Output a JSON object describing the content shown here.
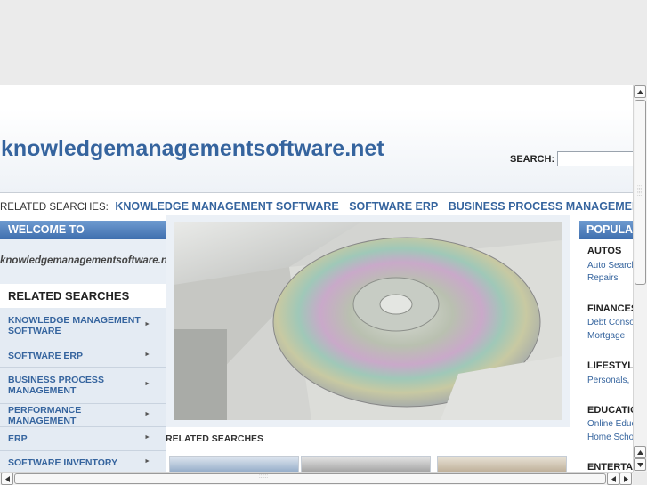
{
  "site": {
    "title": "knowledgemanagementsoftware.net"
  },
  "search": {
    "label": "SEARCH:",
    "value": ""
  },
  "related_bar": {
    "label": "RELATED SEARCHES:",
    "links": [
      "KNOWLEDGE MANAGEMENT SOFTWARE",
      "SOFTWARE ERP",
      "BUSINESS PROCESS MANAGEMENT"
    ]
  },
  "welcome": {
    "heading": "WELCOME TO",
    "domain": "knowledgemanagementsoftware.net"
  },
  "sidebar": {
    "heading": "RELATED SEARCHES",
    "items": [
      {
        "label": "KNOWLEDGE MANAGEMENT SOFTWARE"
      },
      {
        "label": "SOFTWARE ERP"
      },
      {
        "label": "BUSINESS PROCESS MANAGEMENT"
      },
      {
        "label": "PERFORMANCE MANAGEMENT"
      },
      {
        "label": "ERP"
      },
      {
        "label": "SOFTWARE INVENTORY"
      }
    ]
  },
  "center": {
    "related_label": "RELATED SEARCHES"
  },
  "popular": {
    "heading": "POPULAR",
    "categories": [
      {
        "name": "AUTOS",
        "links": [
          "Auto Search",
          "Repairs"
        ]
      },
      {
        "name": "FINANCES",
        "links": [
          "Debt Conso",
          "Mortgage"
        ]
      },
      {
        "name": "LIFESTYLE",
        "links": [
          "Personals,"
        ]
      },
      {
        "name": "EDUCATION",
        "links": [
          "Online Educ",
          "Home Scho"
        ]
      },
      {
        "name": "ENTERTA",
        "links": []
      }
    ]
  },
  "colors": {
    "brand": "#35649e",
    "header_bar": "#3e6eae",
    "panel": "#e4ebf3"
  },
  "icons": {
    "scroll_up": "triangle-up",
    "scroll_down": "triangle-down",
    "scroll_left": "triangle-left",
    "scroll_right": "triangle-right"
  }
}
